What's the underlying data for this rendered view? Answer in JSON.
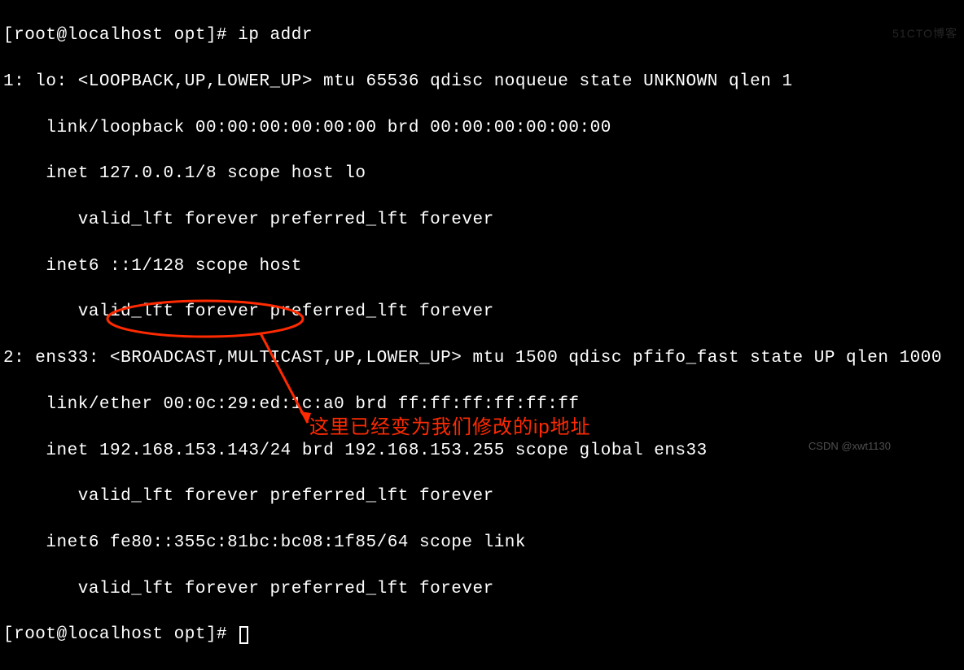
{
  "prompt1": "[root@localhost opt]# ",
  "command": "ip addr",
  "output": {
    "line1": "1: lo: <LOOPBACK,UP,LOWER_UP> mtu 65536 qdisc noqueue state UNKNOWN qlen 1",
    "line2": "    link/loopback 00:00:00:00:00:00 brd 00:00:00:00:00:00",
    "line3": "    inet 127.0.0.1/8 scope host lo",
    "line4": "       valid_lft forever preferred_lft forever",
    "line5": "    inet6 ::1/128 scope host",
    "line6": "       valid_lft forever preferred_lft forever",
    "line7": "2: ens33: <BROADCAST,MULTICAST,UP,LOWER_UP> mtu 1500 qdisc pfifo_fast state UP qlen 1000",
    "line8": "    link/ether 00:0c:29:ed:1c:a0 brd ff:ff:ff:ff:ff:ff",
    "line9a": "    inet ",
    "ip_highlighted": "192.168.153.143",
    "line9b": "/24 brd 192.168.153.255 scope global ens33",
    "line10": "       valid_lft forever preferred_lft forever",
    "line11": "    inet6 fe80::355c:81bc:bc08:1f85/64 scope link",
    "line12": "       valid_lft forever preferred_lft forever"
  },
  "prompt2": "[root@localhost opt]# ",
  "annotation": "这里已经变为我们修改的ip地址",
  "watermark_right": "51CTO博客",
  "watermark_bottom": "CSDN @xwt1130"
}
